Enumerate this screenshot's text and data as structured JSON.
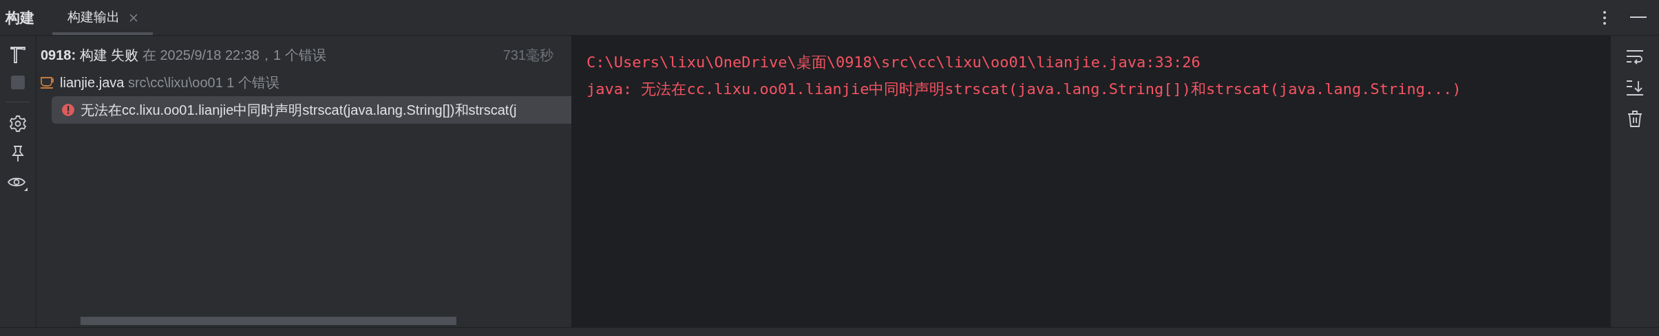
{
  "header": {
    "title": "构建",
    "tabs": [
      {
        "label": "构建输出",
        "selected": true,
        "closable": true
      }
    ]
  },
  "left_toolbar": {
    "items": [
      {
        "kind": "hammer"
      },
      {
        "kind": "stop",
        "disabled": true
      },
      {
        "kind": "gear"
      },
      {
        "kind": "pin"
      },
      {
        "kind": "eye"
      }
    ]
  },
  "tree": {
    "summary": {
      "project": "0918:",
      "action": "构建",
      "result": "失败",
      "detail": "在 2025/9/18 22:38，1 个错误",
      "duration": "731毫秒"
    },
    "items": [
      {
        "file": "lianjie.java",
        "path": "src\\cc\\lixu\\oo01",
        "count": "1 个错误",
        "children": [
          {
            "message": "无法在cc.lixu.oo01.lianjie中同时声明strscat(java.lang.String[])和strscat(j",
            "selected": true
          }
        ]
      }
    ]
  },
  "console": {
    "lines": [
      "C:\\Users\\lixu\\OneDrive\\桌面\\0918\\src\\cc\\lixu\\oo01\\lianjie.java:33:26",
      "java: 无法在cc.lixu.oo01.lianjie中同时声明strscat(java.lang.String[])和strscat(java.lang.String...)"
    ]
  },
  "right_toolbar": {
    "items": [
      {
        "kind": "wrap"
      },
      {
        "kind": "scroll-end"
      },
      {
        "kind": "trash"
      }
    ]
  }
}
